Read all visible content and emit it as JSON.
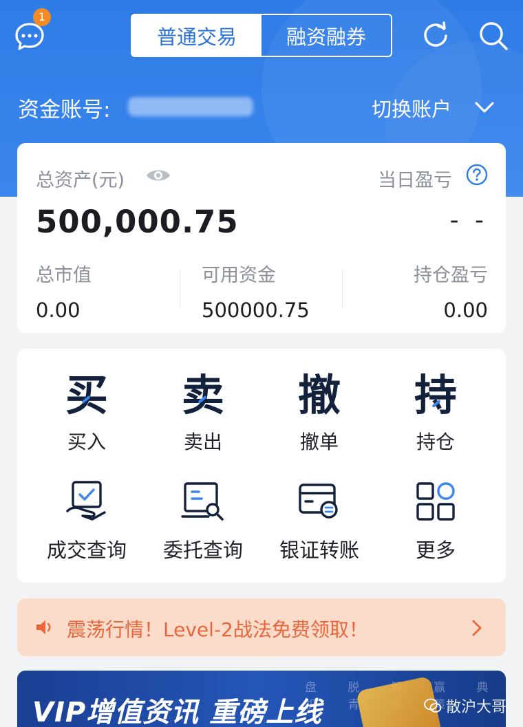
{
  "header": {
    "badge_count": "1",
    "tabs": [
      {
        "label": "普通交易",
        "active": true
      },
      {
        "label": "融资融券",
        "active": false
      }
    ]
  },
  "account": {
    "label": "资金账号:",
    "switch_label": "切换账户"
  },
  "assets": {
    "total_label": "总资产(元)",
    "total_value": "500,000.75",
    "daily_pnl_label": "当日盈亏",
    "daily_pnl_value": "- -",
    "market_value_label": "总市值",
    "market_value": "0.00",
    "available_label": "可用资金",
    "available_value": "500000.75",
    "position_pnl_label": "持仓盈亏",
    "position_pnl_value": "0.00"
  },
  "functions": [
    {
      "glyph": "买",
      "label": "买入"
    },
    {
      "glyph": "卖",
      "label": "卖出"
    },
    {
      "glyph": "撤",
      "label": "撤单"
    },
    {
      "glyph": "持",
      "label": "持仓"
    }
  ],
  "functions2": [
    {
      "icon": "deal-query-icon",
      "label": "成交查询"
    },
    {
      "icon": "order-query-icon",
      "label": "委托查询"
    },
    {
      "icon": "bank-transfer-icon",
      "label": "银证转账"
    },
    {
      "icon": "more-grid-icon",
      "label": "更多"
    }
  ],
  "notice": {
    "text": "震荡行情！Level-2战法免费领取！"
  },
  "vip_banner": {
    "text": "VIP增值资讯 重磅上线",
    "chars": "盘 脱 解 赢 典 机 青 水 策"
  },
  "watermark": {
    "text": "散沪大哥"
  },
  "colors": {
    "brand": "#2f7ce6",
    "notice_text": "#e8663c",
    "badge": "#f58a22"
  }
}
